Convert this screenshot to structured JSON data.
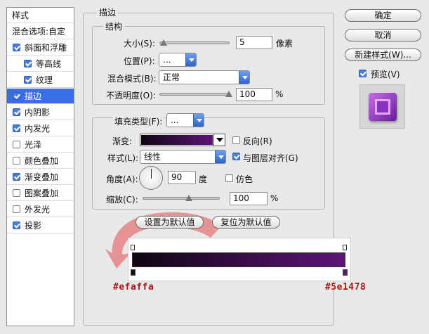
{
  "sidebar": {
    "header": "样式",
    "blend_options": "混合选项:自定",
    "items": [
      {
        "label": "斜面和浮雕",
        "checked": true
      },
      {
        "label": "等高线",
        "checked": true
      },
      {
        "label": "纹理",
        "checked": true
      },
      {
        "label": "描边",
        "checked": true,
        "selected": true
      },
      {
        "label": "内阴影",
        "checked": true
      },
      {
        "label": "内发光",
        "checked": true
      },
      {
        "label": "光泽",
        "checked": false
      },
      {
        "label": "颜色叠加",
        "checked": false
      },
      {
        "label": "渐变叠加",
        "checked": true
      },
      {
        "label": "图案叠加",
        "checked": false
      },
      {
        "label": "外发光",
        "checked": false
      },
      {
        "label": "投影",
        "checked": true
      }
    ]
  },
  "stroke": {
    "title": "描边",
    "structure_title": "结构",
    "size_label": "大小(S):",
    "size_value": "5",
    "size_unit": "像素",
    "size_level": 0,
    "position_label": "位置(P):",
    "position_value": "...",
    "blend_label": "混合模式(B):",
    "blend_value": "正常",
    "opacity_label": "不透明度(O):",
    "opacity_value": "100",
    "opacity_unit": "%",
    "opacity_level": 1.0,
    "fill_type_label": "填充类型(F):",
    "fill_type_value": "...",
    "gradient_label": "渐变:",
    "reverse_label": "反向(R)",
    "reverse_checked": false,
    "style_label": "样式(L):",
    "style_value": "线性",
    "align_label": "与图层对齐(G)",
    "align_checked": true,
    "angle_label": "角度(A):",
    "angle_value": "90",
    "angle_unit": "度",
    "dither_label": "仿色",
    "dither_checked": false,
    "scale_label": "缩放(C):",
    "scale_value": "100",
    "scale_unit": "%",
    "scale_level": 0.5,
    "make_default_button": "设置为默认值",
    "reset_default_button": "复位为默认值"
  },
  "buttons": {
    "ok": "确定",
    "cancel": "取消",
    "new_style": "新建样式(W)...",
    "preview_label": "预览(V)",
    "preview_checked": true
  },
  "gradient_bar": {
    "left_color_label": "#efaffa",
    "right_color_label": "#5e1478",
    "start_color": "#0f0612",
    "end_color": "#5e1478"
  },
  "colors": {
    "accent_selected": "#3a6ee9",
    "hex_label_color": "#b01313",
    "arrow_color": "#e24c4c"
  }
}
